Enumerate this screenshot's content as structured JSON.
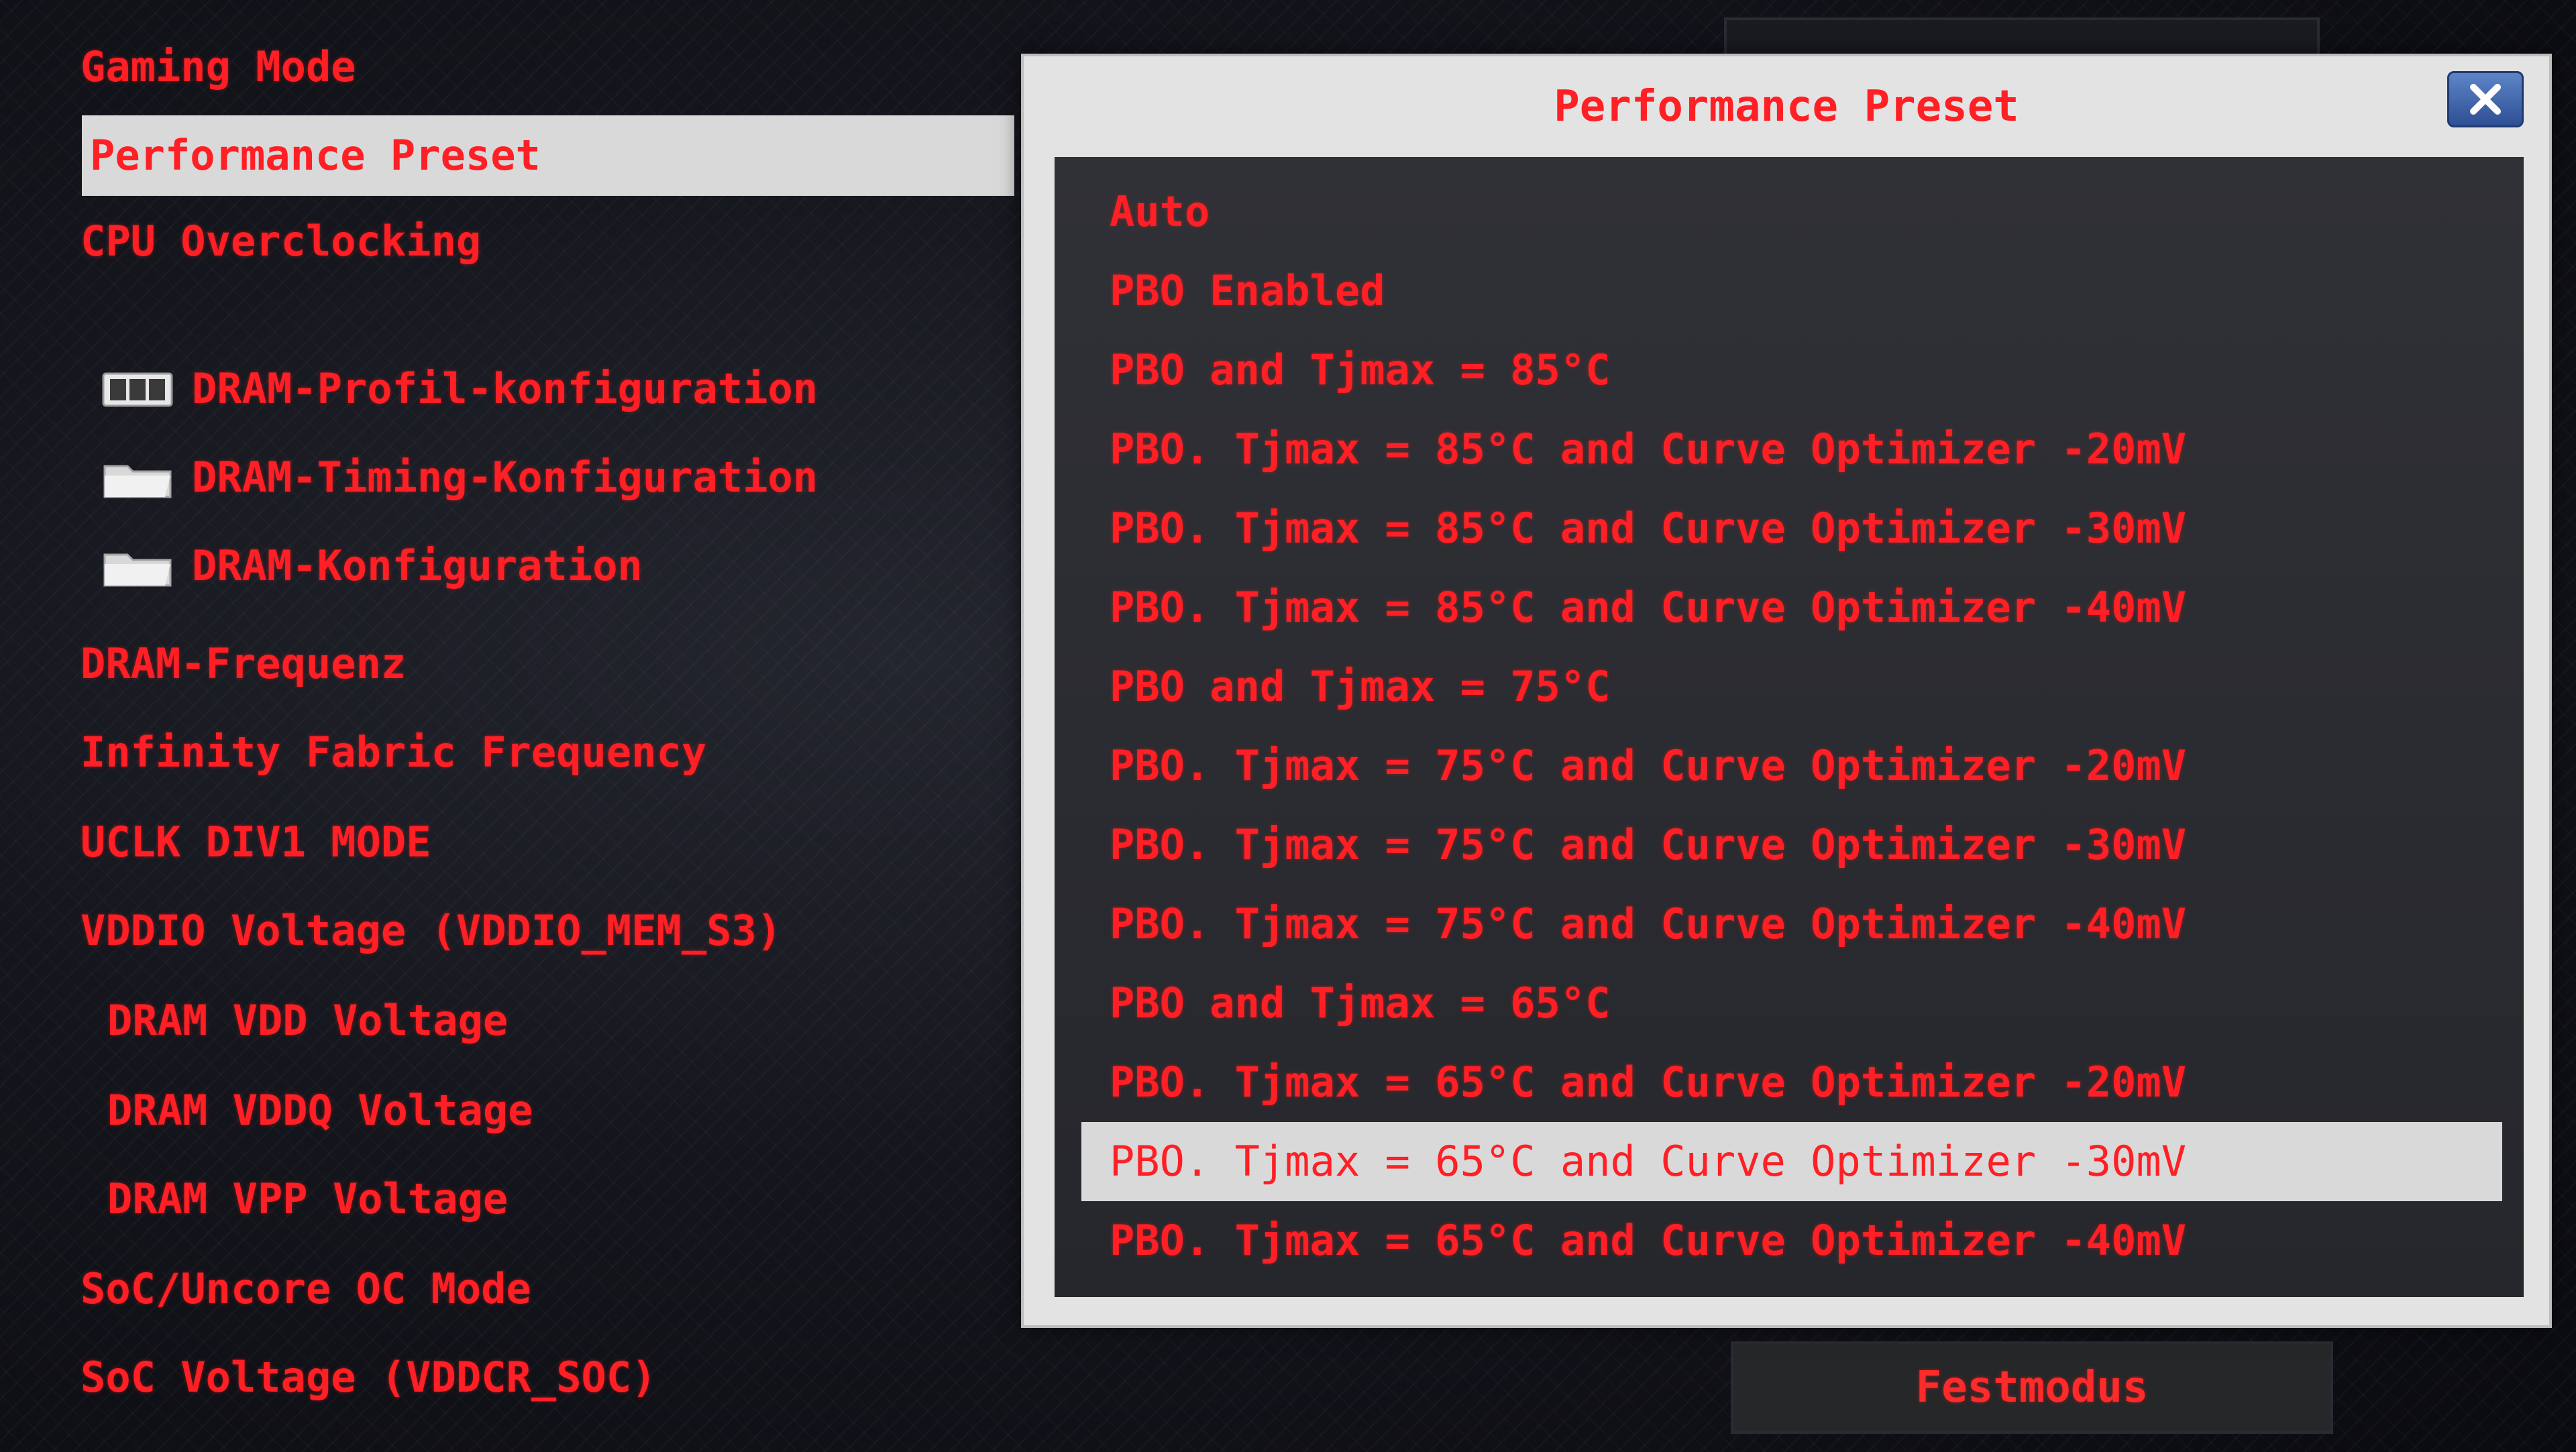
{
  "left_menu": {
    "gaming_mode": "Gaming Mode",
    "performance_preset": "Performance Preset",
    "cpu_overclocking": "CPU Overclocking",
    "dram_profile": "DRAM-Profil-konfiguration",
    "dram_timing": "DRAM-Timing-Konfiguration",
    "dram_config": "DRAM-Konfiguration",
    "dram_freq": "DRAM-Frequenz",
    "infinity_fabric": "Infinity Fabric Frequency",
    "uclk": "UCLK DIV1 MODE",
    "vddio": "VDDIO Voltage (VDDIO_MEM_S3)",
    "dram_vdd": "DRAM VDD Voltage",
    "dram_vddq": "DRAM VDDQ Voltage",
    "dram_vpp": "DRAM VPP Voltage",
    "soc_uncore": "SoC/Uncore OC Mode",
    "soc_voltage": "SoC Voltage (VDDCR_SOC)"
  },
  "right_panel": {
    "bottom_tab": "Festmodus"
  },
  "dialog": {
    "title": "Performance Preset",
    "options": [
      "Auto",
      "PBO Enabled",
      "PBO and Tjmax = 85°C",
      "PBO. Tjmax = 85°C and Curve Optimizer -20mV",
      "PBO. Tjmax = 85°C and Curve Optimizer -30mV",
      "PBO. Tjmax = 85°C and Curve Optimizer -40mV",
      "PBO and Tjmax = 75°C",
      "PBO. Tjmax = 75°C and Curve Optimizer -20mV",
      "PBO. Tjmax = 75°C and Curve Optimizer -30mV",
      "PBO. Tjmax = 75°C and Curve Optimizer -40mV",
      "PBO and Tjmax = 65°C",
      "PBO. Tjmax = 65°C and Curve Optimizer -20mV",
      "PBO. Tjmax = 65°C and Curve Optimizer -30mV",
      "PBO. Tjmax = 65°C and Curve Optimizer -40mV"
    ],
    "selected_index": 12
  },
  "icons": {
    "dram_profile": "chip-icon",
    "dram_timing": "folder-icon",
    "dram_config": "folder-icon",
    "close": "close-icon"
  },
  "colors": {
    "text_red": "#ff1f25",
    "selection_bg": "#d9d9d9",
    "dialog_bg": "#e3e3e3",
    "list_bg": "#2b2c31",
    "close_blue": "#3d63ad"
  }
}
